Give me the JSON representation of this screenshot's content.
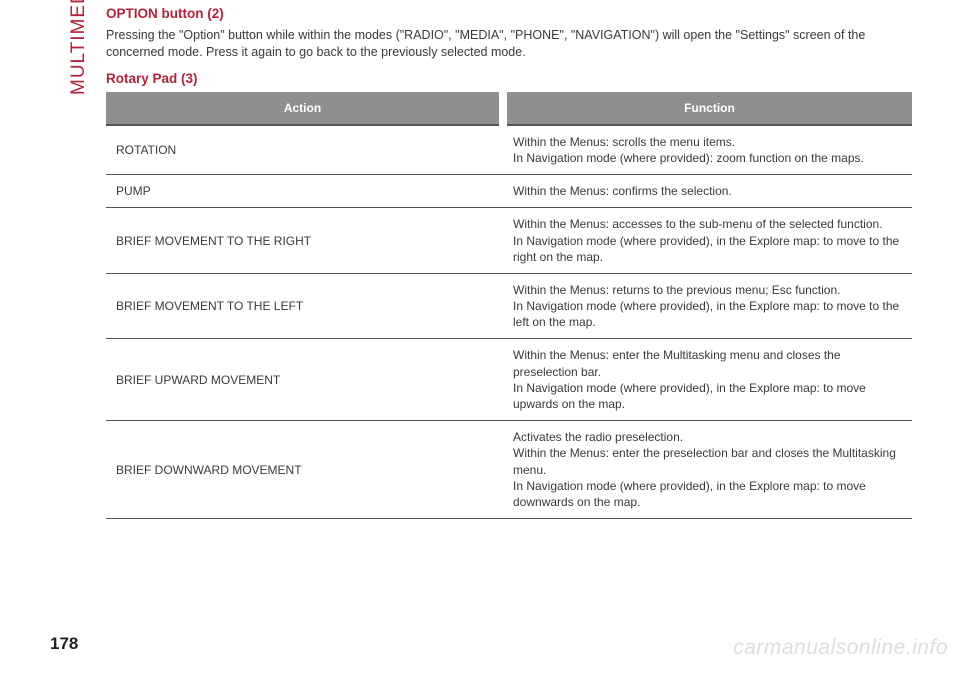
{
  "sideLabel": "MULTIMEDIA",
  "sections": [
    {
      "heading": "OPTION button (2)",
      "body": "Pressing the \"Option\" button while within the modes (\"RADIO\", \"MEDIA\", \"PHONE\", \"NAVIGATION\") will open the \"Settings\" screen of the concerned mode. Press it again to go back to the previously selected mode."
    },
    {
      "heading": "Rotary Pad (3)",
      "body": ""
    }
  ],
  "table": {
    "headers": {
      "action": "Action",
      "function": "Function"
    },
    "rows": [
      {
        "action": "ROTATION",
        "function": "Within the Menus: scrolls the menu items.\nIn Navigation mode (where provided): zoom function on the maps."
      },
      {
        "action": "PUMP",
        "function": "Within the Menus: confirms the selection."
      },
      {
        "action": "BRIEF MOVEMENT TO THE RIGHT",
        "function": "Within the Menus: accesses to the sub-menu of the selected function.\nIn Navigation mode (where provided), in the Explore map: to move to the right on the map."
      },
      {
        "action": "BRIEF MOVEMENT TO THE LEFT",
        "function": "Within the Menus: returns to the previous menu; Esc function.\nIn Navigation mode (where provided), in the Explore map: to move to the left on the map."
      },
      {
        "action": "BRIEF UPWARD MOVEMENT",
        "function": "Within the Menus: enter the Multitasking menu and closes the preselection bar.\nIn Navigation mode (where provided), in the Explore map: to move upwards on the map."
      },
      {
        "action": "BRIEF DOWNWARD MOVEMENT",
        "function": "Activates the radio preselection.\nWithin the Menus: enter the preselection bar and closes the Multitasking menu.\nIn Navigation mode (where provided), in the Explore map: to move downwards on the map."
      }
    ]
  },
  "pageNumber": "178",
  "watermark": "carmanualsonline.info"
}
